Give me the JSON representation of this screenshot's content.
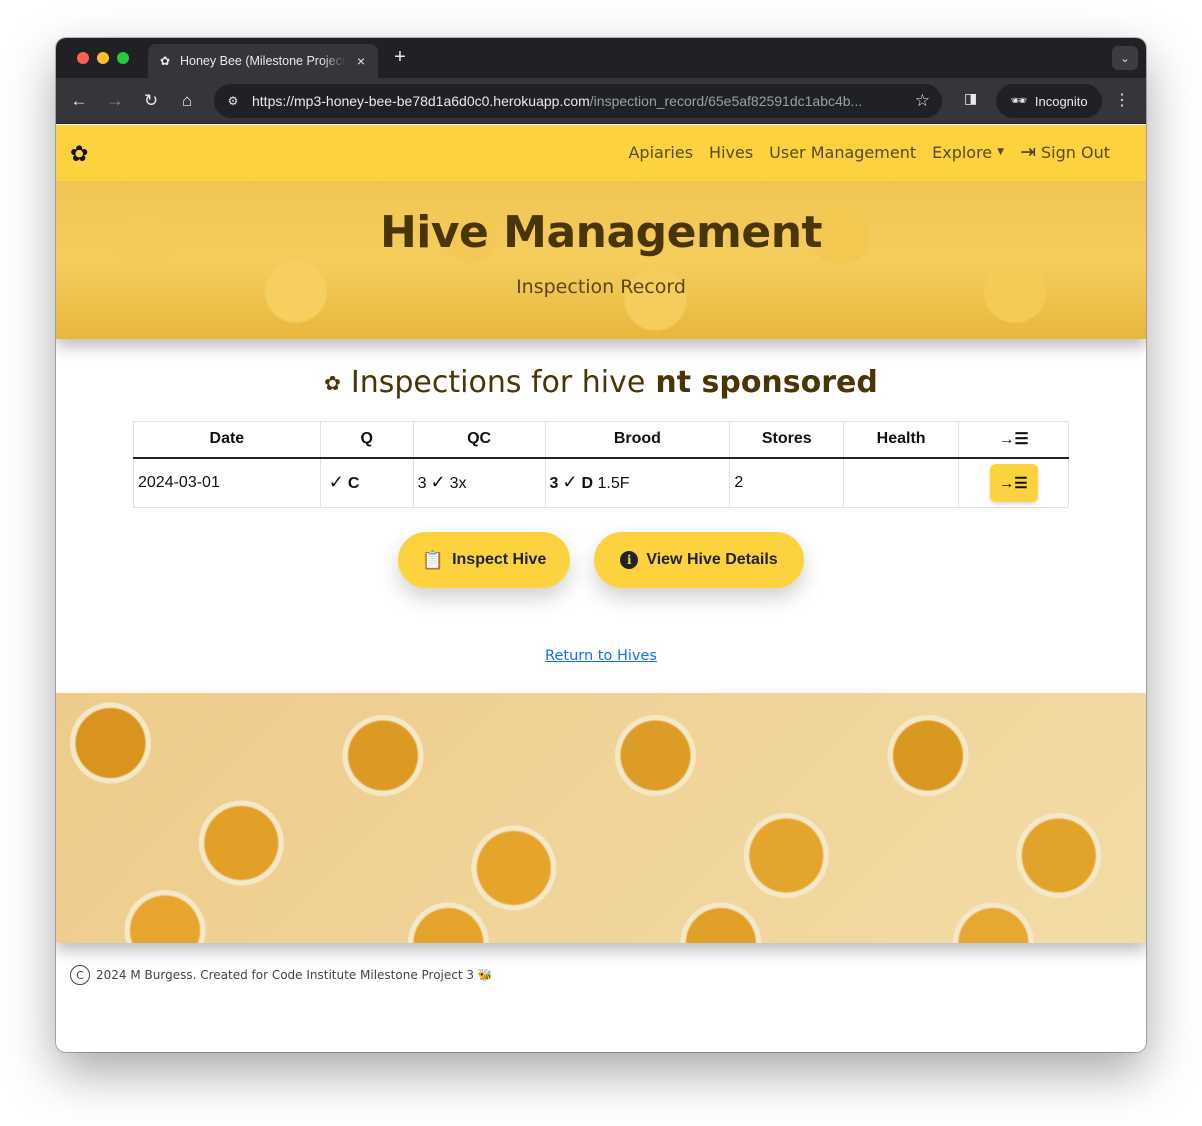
{
  "browser": {
    "tab_title": "Honey Bee (Milestone Project",
    "tab_icon": "flower-icon",
    "url_main": "https://mp3-honey-bee-be78d1a6d0c0.herokuapp.com",
    "url_path": "/inspection_record/65e5af82591dc1abc4b...",
    "profile_label": "Incognito"
  },
  "navbar": {
    "brand_icon": "flower-icon",
    "links": [
      "Apiaries",
      "Hives",
      "User Management",
      "Explore"
    ],
    "signout": "Sign Out",
    "color": "#fcd23f"
  },
  "hero": {
    "title": "Hive Management",
    "subtitle": "Inspection Record"
  },
  "section": {
    "title_prefix": "Inspections for hive",
    "hive_name": "nt sponsored"
  },
  "table": {
    "headers": [
      "Date",
      "Q",
      "QC",
      "Brood",
      "Stores",
      "Health",
      "→☰"
    ],
    "rows": [
      {
        "date": "2024-03-01",
        "q_mark": "✓",
        "q_text": "C",
        "qc_num": "3",
        "qc_mark": "✓",
        "qc_text": "3x",
        "brood_num": "3",
        "brood_mark": "✓",
        "brood_letter": "D",
        "brood_text": "1.5F",
        "stores": "2",
        "health": "",
        "action": "→☰"
      }
    ]
  },
  "buttons": {
    "inspect": "Inspect Hive",
    "details": "View Hive Details"
  },
  "return_link": "Return to Hives",
  "footer": {
    "copyright": "2024 M Burgess. Created for Code Institute Milestone Project 3 🐝"
  }
}
